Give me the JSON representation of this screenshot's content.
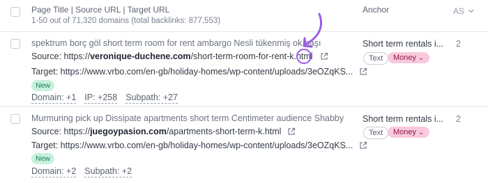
{
  "header": {
    "page_title_col": "Page Title | Source URL | Target URL",
    "summary": "1-50 out of 71,320 domains (total backlinks: 877,553)",
    "anchor_col": "Anchor",
    "as_col": "AS"
  },
  "rows": [
    {
      "title": "spektrum borç göl short term room for rent ambargo Nesli tükenmiş ok başı",
      "source_prefix": "Source: https://",
      "source_domain": "veronique-duchene.com",
      "source_path": "/short-term-room-for-rent-k.html",
      "target": "Target: https://www.vrbo.com/en-gb/holiday-homes/wp-content/uploads/3eOZqKS...",
      "badge": "New",
      "metrics": [
        "Domain: +1",
        "IP: +258",
        "Subpath: +27"
      ],
      "anchor": "Short term rentals i...",
      "tag_text": "Text",
      "tag_money": "Money",
      "as": "2"
    },
    {
      "title": "Murmuring pick up Dissipate apartments short term Centimeter audience Shabby",
      "source_prefix": "Source: https://",
      "source_domain": "juegoypasion.com",
      "source_path": "/apartments-short-term-k.html",
      "target": "Target: https://www.vrbo.com/en-gb/holiday-homes/wp-content/uploads/3eOZqKS...",
      "badge": "New",
      "metrics": [
        "Domain: +2",
        "Subpath: +2"
      ],
      "anchor": "Short term rentals i...",
      "tag_text": "Text",
      "tag_money": "Money",
      "as": "2"
    }
  ],
  "icons": {
    "external_link": "external-link-icon",
    "sort": "sort-icon",
    "chevron": "chevron-down-icon"
  },
  "colors": {
    "accent_purple": "#9b5be6",
    "new_badge_bg": "#c6f1dd",
    "money_badge_bg": "#f9c9dd"
  }
}
